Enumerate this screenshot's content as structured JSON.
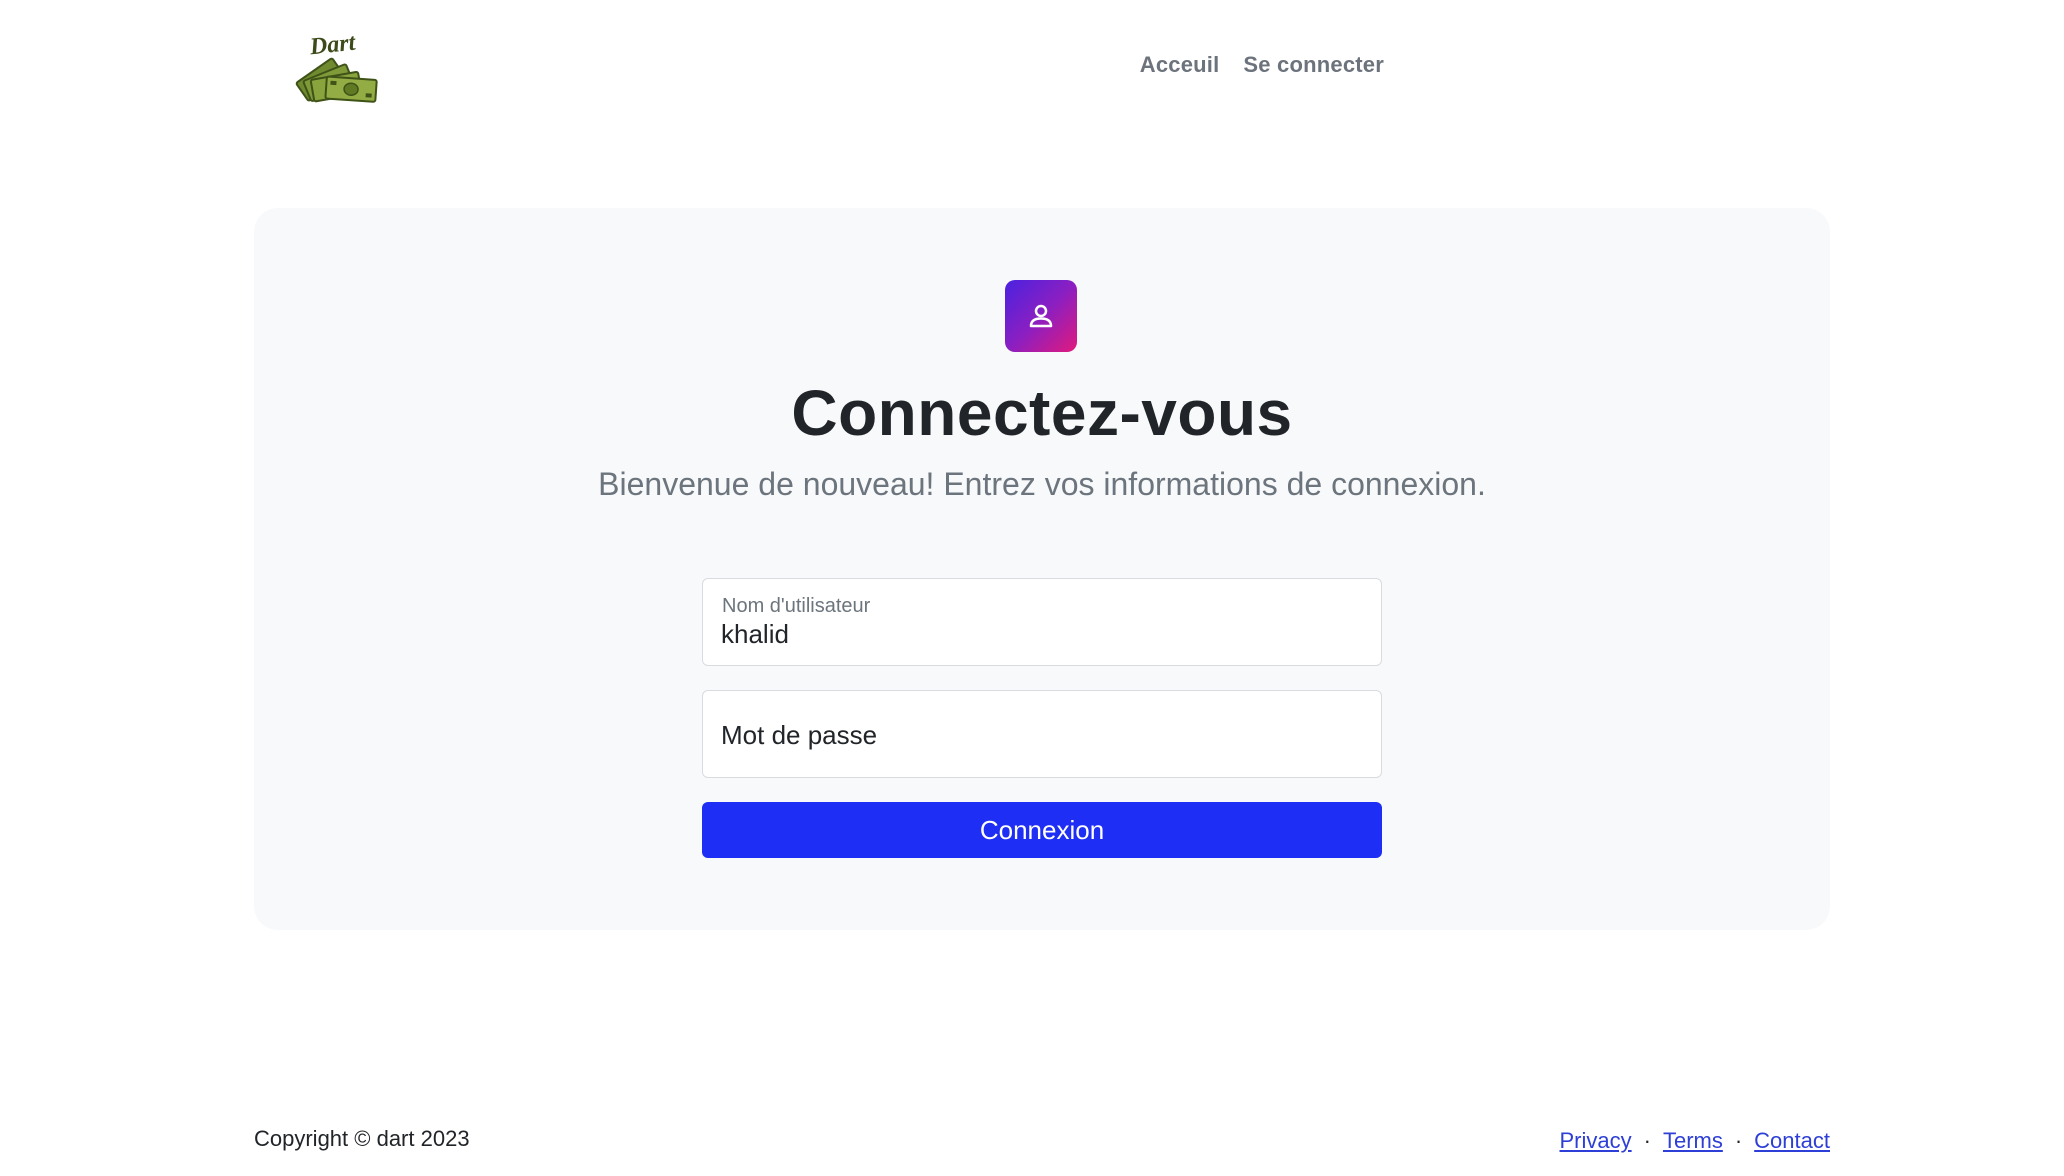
{
  "navbar": {
    "brand": "Dart",
    "links": [
      {
        "label": "Acceuil"
      },
      {
        "label": "Se connecter"
      }
    ]
  },
  "login": {
    "title": "Connectez-vous",
    "subtitle": "Bienvenue de nouveau! Entrez vos informations de connexion.",
    "username": {
      "label": "Nom d'utilisateur",
      "value": "khalid"
    },
    "password": {
      "placeholder": "Mot de passe"
    },
    "submit_label": "Connexion",
    "badge_colors": [
      "#4a22e0",
      "#e11a7c"
    ],
    "button_color": "#1f2ef5"
  },
  "footer": {
    "copyright": "Copyright © dart 2023",
    "links": [
      {
        "label": "Privacy"
      },
      {
        "label": "Terms"
      },
      {
        "label": "Contact"
      }
    ],
    "separator": "·"
  }
}
